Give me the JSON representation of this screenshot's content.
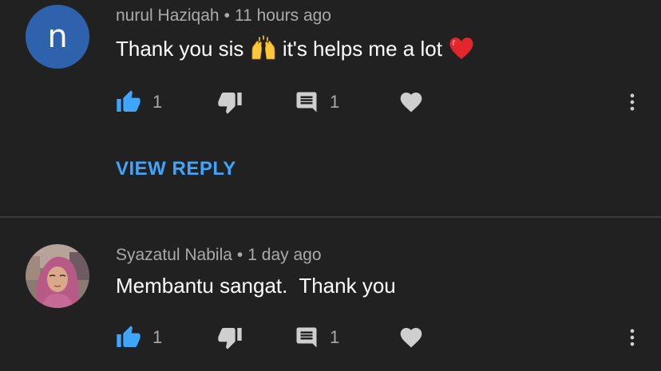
{
  "comments": [
    {
      "avatar_letter": "n",
      "author": "nurul Haziqah",
      "separator": "•",
      "time": "11 hours ago",
      "text_before": "Thank you sis ",
      "emoji_1": "raising-hands",
      "text_after": " it's helps me a lot ",
      "emoji_2": "red-heart",
      "likes": "1",
      "replies": "1",
      "view_reply_label": "VIEW REPLY"
    },
    {
      "author": "Syazatul Nabila",
      "separator": "•",
      "time": "1 day ago",
      "text": "Membantu sangat.  Thank you",
      "likes": "1",
      "replies": "1"
    }
  ],
  "colors": {
    "background": "#212121",
    "accent_blue": "#3ea6ff",
    "muted_text": "#aaaaaa",
    "icon_gray": "#cfcfcf",
    "avatar_blue": "#2f62ad",
    "divider": "#3a3a3a"
  }
}
